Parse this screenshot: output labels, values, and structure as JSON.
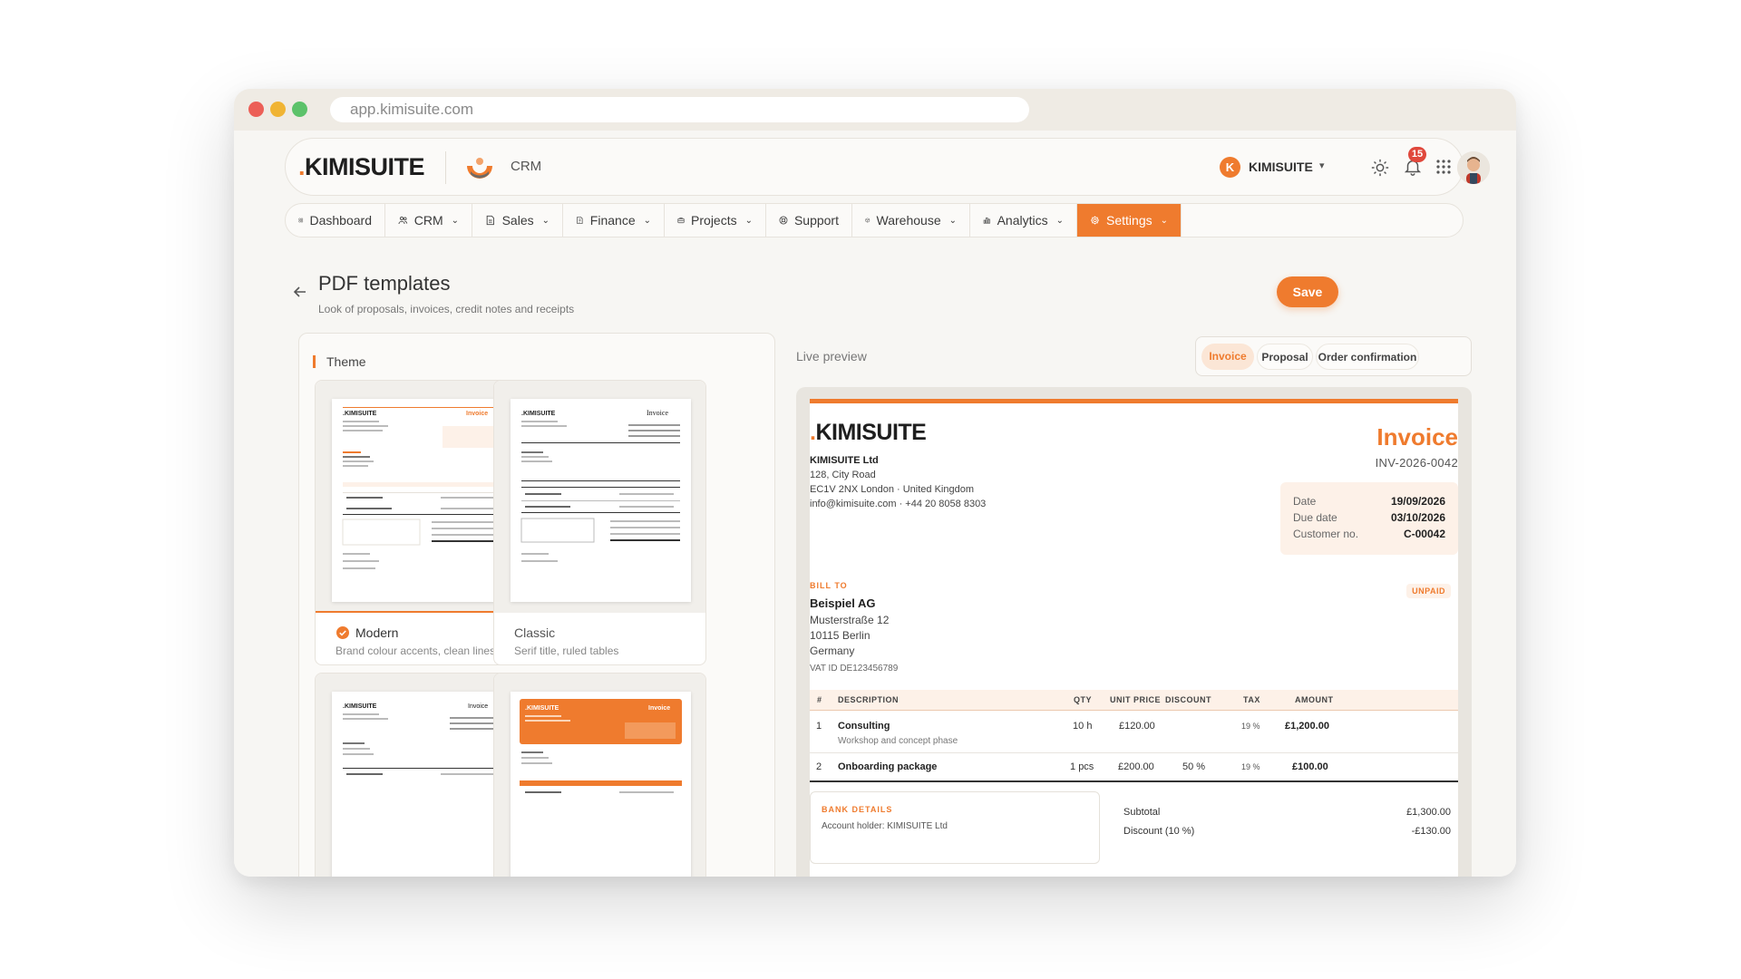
{
  "browser": {
    "url": "app.kimisuite.com"
  },
  "header": {
    "logo_dot": ".",
    "logo_text": "KIMISUITE",
    "module_label": "CRM",
    "org_initial": "K",
    "org_name": "KIMISUITE",
    "notification_count": "15"
  },
  "nav": [
    {
      "label": "Dashboard",
      "icon": "dashboard-icon"
    },
    {
      "label": "CRM",
      "icon": "users-icon"
    },
    {
      "label": "Sales",
      "icon": "document-icon"
    },
    {
      "label": "Finance",
      "icon": "invoice-icon"
    },
    {
      "label": "Projects",
      "icon": "briefcase-icon"
    },
    {
      "label": "Support",
      "icon": "lifebuoy-icon"
    },
    {
      "label": "Warehouse",
      "icon": "box-icon"
    },
    {
      "label": "Analytics",
      "icon": "bar-chart-icon"
    },
    {
      "label": "Settings",
      "icon": "gear-icon",
      "active": true
    }
  ],
  "page": {
    "title": "PDF templates",
    "subtitle": "Look of proposals, invoices, credit notes and receipts",
    "save_label": "Save"
  },
  "theme": {
    "label": "Theme",
    "cards": [
      {
        "name": "Modern",
        "desc": "Brand colour accents, clean lines",
        "selected": true
      },
      {
        "name": "Classic",
        "desc": "Serif title, ruled tables",
        "selected": false
      }
    ]
  },
  "preview": {
    "label": "Live preview",
    "tabs": [
      "Invoice",
      "Proposal",
      "Order confirmation"
    ],
    "active_tab": "Invoice"
  },
  "invoice": {
    "title": "Invoice",
    "number": "INV-2026-0042",
    "company_name": "KIMISUITE Ltd",
    "company_street": "128, City Road",
    "company_city": "EC1V 2NX London · United Kingdom",
    "company_contact": "info@kimisuite.com · +44 20 8058 8303",
    "meta": [
      {
        "key": "Date",
        "value": "19/09/2026"
      },
      {
        "key": "Due date",
        "value": "03/10/2026"
      },
      {
        "key": "Customer no.",
        "value": "C-00042"
      }
    ],
    "bill_to_label": "BILL TO",
    "bill_to_name": "Beispiel AG",
    "bill_to_street": "Musterstraße 12",
    "bill_to_city": "10115 Berlin",
    "bill_to_country": "Germany",
    "bill_to_vat": "VAT ID DE123456789",
    "status": "UNPAID",
    "columns": [
      "#",
      "DESCRIPTION",
      "QTY",
      "UNIT PRICE",
      "DISCOUNT",
      "TAX",
      "AMOUNT"
    ],
    "items": [
      {
        "no": "1",
        "desc": "Consulting",
        "sub": "Workshop and concept phase",
        "qty": "10",
        "unit": "h",
        "price": "£120.00",
        "discount": "",
        "tax": "19 %",
        "amount": "£1,200.00"
      },
      {
        "no": "2",
        "desc": "Onboarding package",
        "sub": "",
        "qty": "1",
        "unit": "pcs",
        "price": "£200.00",
        "discount": "50 %",
        "tax": "19 %",
        "amount": "£100.00"
      }
    ],
    "bank_label": "BANK DETAILS",
    "bank_line": "Account holder: KIMISUITE Ltd",
    "totals": [
      {
        "label": "Subtotal",
        "value": "£1,300.00"
      },
      {
        "label": "Discount (10 %)",
        "value": "-£130.00"
      }
    ]
  },
  "colors": {
    "accent": "#ef7b2e",
    "background": "#f7f6f3",
    "badge": "#e0483c"
  }
}
